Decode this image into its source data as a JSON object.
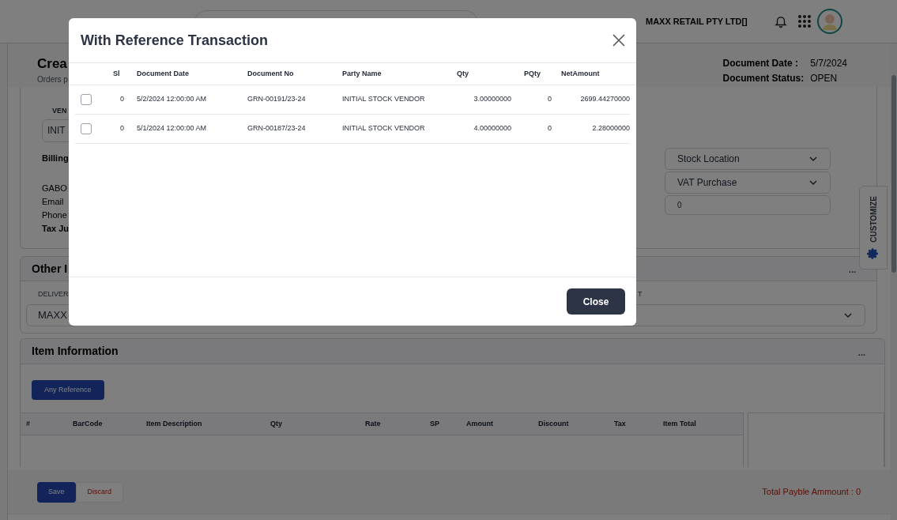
{
  "header": {
    "company": "MAXX RETAIL PTY LTD[]"
  },
  "page": {
    "title": "Crea",
    "subtitle": "Orders p",
    "document_date_label": "Document Date :",
    "document_date": "5/7/2024",
    "document_status_label": "Document Status:",
    "document_status": "OPEN"
  },
  "vendor_section": {
    "field_label": "VEN",
    "field_value": "INIT",
    "billing_label": "Billing",
    "address_lines": [
      "GABO",
      "Email",
      "Phone"
    ],
    "tax_label": "Tax Ju",
    "selects": [
      "Stock Location",
      "VAT Purchase"
    ],
    "number_field": "0"
  },
  "other_section": {
    "title": "Other I",
    "menu": "...",
    "delivery_label": "DELIVER",
    "delivery_value": "MAXX",
    "column_3_label": "T"
  },
  "item_section": {
    "title": "Item Information",
    "menu": "...",
    "reference_button": "Any Reference",
    "columns": [
      "#",
      "BarCode",
      "Item Description",
      "Qty",
      "Rate",
      "SP",
      "Amount",
      "Discount",
      "Tax",
      "Item Total"
    ]
  },
  "footer": {
    "buttons": [
      {
        "label": "Save",
        "kind": "primary"
      },
      {
        "label": "Discard",
        "kind": "danger"
      }
    ],
    "total": "Total Payble Ammount : 0"
  },
  "customize_tab": "CUSTOMIZE",
  "dialog": {
    "title": "With Reference Transaction",
    "columns": [
      "Sl",
      "Document Date",
      "Document No",
      "Party Name",
      "Qty",
      "PQty",
      "NetAmount"
    ],
    "rows": [
      {
        "checked": false,
        "sl": "0",
        "document_date": "5/2/2024 12:00:00 AM",
        "document_no": "GRN-00191/23-24",
        "party_name": "INITIAL STOCK VENDOR",
        "qty": "3.00000000",
        "pqty": "0",
        "net_amount": "2699.44270000"
      },
      {
        "checked": false,
        "sl": "0",
        "document_date": "5/1/2024 12:00:00 AM",
        "document_no": "GRN-00187/23-24",
        "party_name": "INITIAL STOCK VENDOR",
        "qty": "4.00000000",
        "pqty": "0",
        "net_amount": "2.28000000"
      }
    ],
    "close_button": "Close"
  }
}
